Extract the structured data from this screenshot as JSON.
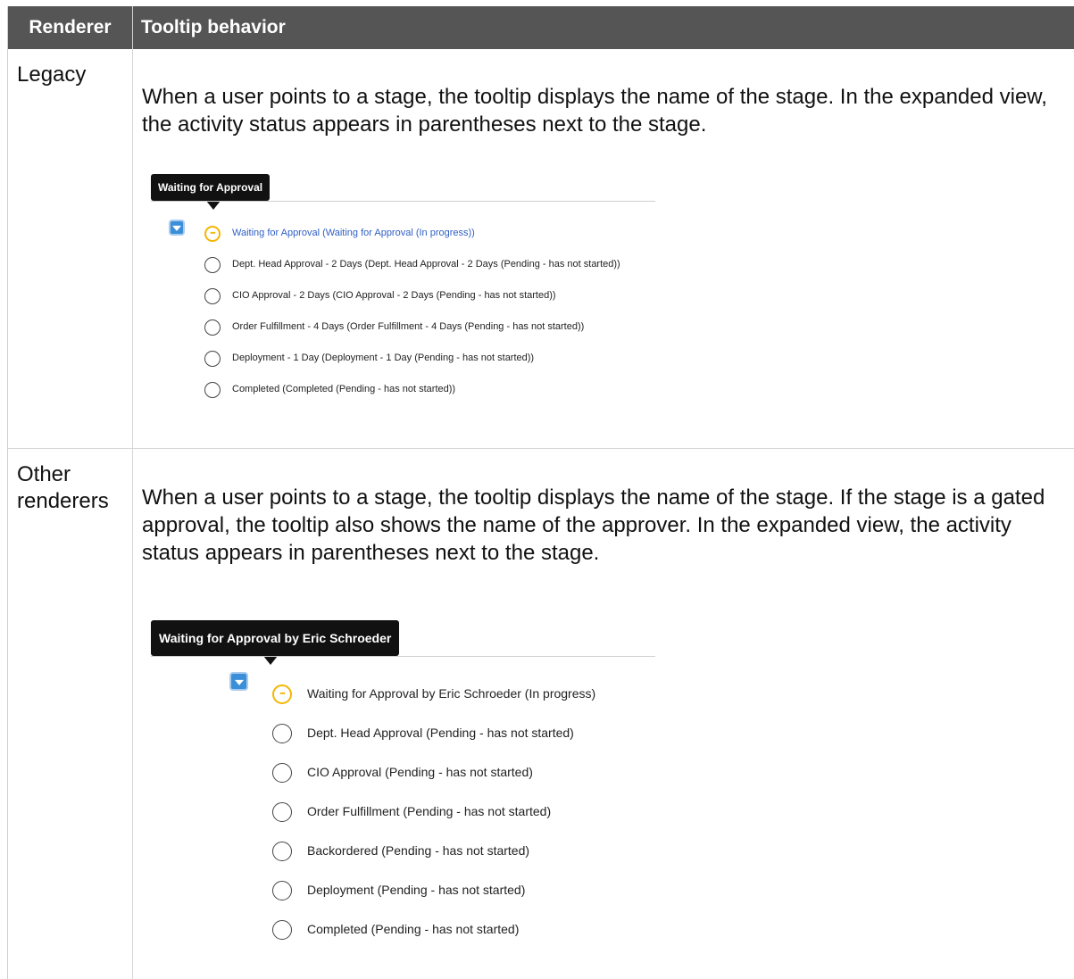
{
  "header": {
    "col1": "Renderer",
    "col2": "Tooltip behavior"
  },
  "rows": [
    {
      "renderer": "Legacy",
      "description": "When a user points to a stage, the tooltip displays the name of the stage. In the expanded view, the activity status appears in parentheses next to the stage.",
      "tooltip": "Waiting for Approval",
      "stages": [
        {
          "label": "Waiting for Approval (Waiting for Approval (In progress))",
          "state": "in-progress"
        },
        {
          "label": "Dept. Head Approval - 2 Days (Dept. Head Approval - 2 Days (Pending - has not started))",
          "state": "pending"
        },
        {
          "label": "CIO Approval - 2 Days (CIO Approval - 2 Days (Pending - has not started))",
          "state": "pending"
        },
        {
          "label": "Order Fulfillment - 4 Days (Order Fulfillment - 4 Days (Pending - has not started))",
          "state": "pending"
        },
        {
          "label": "Deployment - 1 Day (Deployment - 1 Day (Pending - has not started))",
          "state": "pending"
        },
        {
          "label": "Completed (Completed (Pending - has not started))",
          "state": "pending"
        }
      ]
    },
    {
      "renderer_line1": "Other",
      "renderer_line2": "renderers",
      "description": "When a user points to a stage, the tooltip displays the name of the stage. If the stage is a gated approval, the tooltip also shows the name of the approver. In the expanded view, the activity status appears in parentheses next to the stage.",
      "tooltip": "Waiting for Approval by Eric Schroeder",
      "stages": [
        {
          "label": "Waiting for Approval by Eric Schroeder (In progress)",
          "state": "in-progress"
        },
        {
          "label": "Dept. Head Approval (Pending - has not started)",
          "state": "pending"
        },
        {
          "label": "CIO Approval (Pending - has not started)",
          "state": "pending"
        },
        {
          "label": "Order Fulfillment (Pending - has not started)",
          "state": "pending"
        },
        {
          "label": "Backordered (Pending - has not started)",
          "state": "pending"
        },
        {
          "label": "Deployment (Pending - has not started)",
          "state": "pending"
        },
        {
          "label": "Completed (Pending - has not started)",
          "state": "pending"
        }
      ]
    }
  ],
  "colors": {
    "header_bg": "#555555",
    "link_blue": "#2f5fc4",
    "progress_yellow": "#f2b705",
    "expand_blue": "#3b8fd9"
  }
}
